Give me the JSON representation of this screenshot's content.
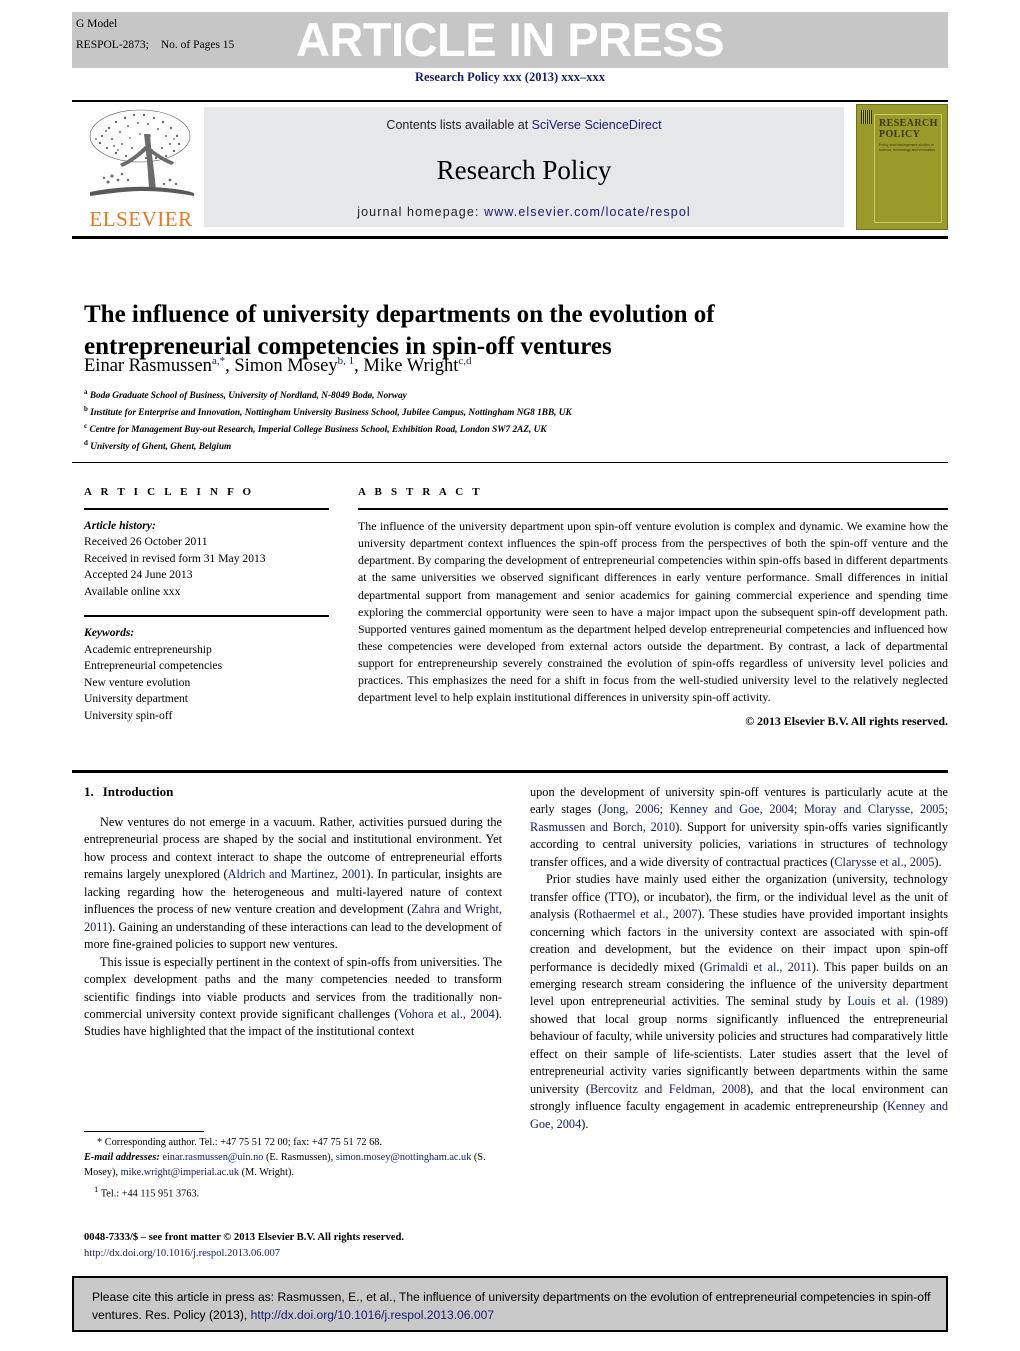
{
  "header": {
    "g_model": "G Model",
    "respol_id": "RESPOL-2873;",
    "pages": "No. of Pages 15",
    "press_banner": "ARTICLE IN PRESS",
    "journal_ref": "Research Policy xxx (2013) xxx–xxx"
  },
  "masthead": {
    "contents_prefix": "Contents lists available at ",
    "contents_link": "SciVerse ScienceDirect",
    "journal_name": "Research Policy",
    "homepage_prefix": "journal homepage: ",
    "homepage_url": "www.elsevier.com/locate/respol",
    "publisher": "ELSEVIER",
    "cover_title_line1": "RESEARCH",
    "cover_title_line2": "POLICY",
    "cover_subtitle": "Policy and management studies in science, technology and innovation"
  },
  "article": {
    "title": "The influence of university departments on the evolution of entrepreneurial competencies in spin-off ventures",
    "authors": [
      {
        "name": "Einar Rasmussen",
        "sup": "a,*"
      },
      {
        "name": "Simon Mosey",
        "sup": "b, 1"
      },
      {
        "name": "Mike Wright",
        "sup": "c,d"
      }
    ],
    "affiliations": [
      {
        "mark": "a",
        "text": "Bodø Graduate School of Business, University of Nordland, N-8049 Bodø, Norway"
      },
      {
        "mark": "b",
        "text": "Institute for Enterprise and Innovation, Nottingham University Business School, Jubilee Campus, Nottingham NG8 1BB, UK"
      },
      {
        "mark": "c",
        "text": "Centre for Management Buy-out Research, Imperial College Business School, Exhibition Road, London SW7 2AZ, UK"
      },
      {
        "mark": "d",
        "text": "University of Ghent, Ghent, Belgium"
      }
    ]
  },
  "article_info": {
    "heading": "A R T I C L E   I N F O",
    "history_label": "Article history:",
    "history": [
      "Received 26 October 2011",
      "Received in revised form 31 May 2013",
      "Accepted 24 June 2013",
      "Available online xxx"
    ],
    "keywords_label": "Keywords:",
    "keywords": [
      "Academic entrepreneurship",
      "Entrepreneurial competencies",
      "New venture evolution",
      "University department",
      "University spin-off"
    ]
  },
  "abstract": {
    "heading": "A B S T R A C T",
    "text": "The influence of the university department upon spin-off venture evolution is complex and dynamic. We examine how the university department context influences the spin-off process from the perspectives of both the spin-off venture and the department. By comparing the development of entrepreneurial competencies within spin-offs based in different departments at the same universities we observed significant differences in early venture performance. Small differences in initial departmental support from management and senior academics for gaining commercial experience and spending time exploring the commercial opportunity were seen to have a major impact upon the subsequent spin-off development path. Supported ventures gained momentum as the department helped develop entrepreneurial competencies and influenced how these competencies were developed from external actors outside the department. By contrast, a lack of departmental support for entrepreneurship severely constrained the evolution of spin-offs regardless of university level policies and practices. This emphasizes the need for a shift in focus from the well-studied university level to the relatively neglected department level to help explain institutional differences in university spin-off activity.",
    "copyright": "© 2013 Elsevier B.V. All rights reserved."
  },
  "introduction": {
    "number": "1.",
    "heading": "Introduction",
    "left_paragraph_1_a": "New ventures do not emerge in a vacuum. Rather, activities pursued during the entrepreneurial process are shaped by the social and institutional environment. Yet how process and context interact to shape the outcome of entrepreneurial efforts remains largely unexplored (",
    "left_paragraph_1_ref1": "Aldrich and Martinez, 2001",
    "left_paragraph_1_b": "). In particular, insights are lacking regarding how the heterogeneous and multi-layered nature of context influences the process of new venture creation and development (",
    "left_paragraph_1_ref2": "Zahra and Wright, 2011",
    "left_paragraph_1_c": "). Gaining an understanding of these interactions can lead to the development of more fine-grained policies to support new ventures.",
    "left_paragraph_2_a": "This issue is especially pertinent in the context of spin-offs from universities. The complex development paths and the many competencies needed to transform scientific findings into viable products and services from the traditionally non-commercial university context provide significant challenges (",
    "left_paragraph_2_ref1": "Vohora et al., 2004",
    "left_paragraph_2_b": "). Studies have highlighted that the impact of the institutional context",
    "right_paragraph_1_a": "upon the development of university spin-off ventures is particularly acute at the early stages (",
    "right_paragraph_1_ref1": "Jong, 2006; Kenney and Goe, 2004; Moray and Clarysse, 2005; Rasmussen and Borch, 2010",
    "right_paragraph_1_b": "). Support for university spin-offs varies significantly according to central university policies, variations in structures of technology transfer offices, and a wide diversity of contractual practices (",
    "right_paragraph_1_ref2": "Clarysse et al., 2005",
    "right_paragraph_1_c": ").",
    "right_paragraph_2_a": "Prior studies have mainly used either the organization (university, technology transfer office (TTO), or incubator), the firm, or the individual level as the unit of analysis (",
    "right_paragraph_2_ref1": "Rothaermel et al., 2007",
    "right_paragraph_2_b": "). These studies have provided important insights concerning which factors in the university context are associated with spin-off creation and development, but the evidence on their impact upon spin-off performance is decidedly mixed (",
    "right_paragraph_2_ref2": "Grimaldi et al., 2011",
    "right_paragraph_2_c": "). This paper builds on an emerging research stream considering the influence of the university department level upon entrepreneurial activities. The seminal study by ",
    "right_paragraph_2_ref3": "Louis et al. (1989)",
    "right_paragraph_2_d": " showed that local group norms significantly influenced the entrepreneurial behaviour of faculty, while university policies and structures had comparatively little effect on their sample of life-scientists. Later studies assert that the level of entrepreneurial activity varies significantly between departments within the same university (",
    "right_paragraph_2_ref4": "Bercovitz and Feldman, 2008",
    "right_paragraph_2_e": "), and that the local environment can strongly influence faculty engagement in academic entrepreneurship (",
    "right_paragraph_2_ref5": "Kenney and Goe, 2004",
    "right_paragraph_2_f": ")."
  },
  "footnotes": {
    "corresponding": "* Corresponding author. Tel.: +47 75 51 72 00; fax: +47 75 51 72 68.",
    "email_label": "E-mail addresses:",
    "email1": "einar.rasmussen@uin.no",
    "email1_attr": " (E. Rasmussen),",
    "email2": "simon.mosey@nottingham.ac.uk",
    "email2_attr": " (S. Mosey),",
    "email3": "mike.wright@imperial.ac.uk",
    "email3_attr": "(M. Wright).",
    "tel_sup": "1",
    "tel": "Tel.: +44 115 951 3763.",
    "issn_line": "0048-7333/$ – see front matter © 2013 Elsevier B.V. All rights reserved.",
    "doi_line": "http://dx.doi.org/10.1016/j.respol.2013.06.007"
  },
  "cite_box": {
    "text": "Please cite this article in press as: Rasmussen, E., et al., The influence of university departments on the evolution of entrepreneurial competencies in spin-off ventures. Res. Policy (2013), ",
    "doi": "http://dx.doi.org/10.1016/j.respol.2013.06.007"
  },
  "colors": {
    "link": "#15206b",
    "banner_bg": "#c6c6c6",
    "masthead_bg": "#e6e7e8",
    "elsevier_orange": "#e87722",
    "cover_olive": "#9a9a2a",
    "cite_bg": "#c9c9c9"
  }
}
